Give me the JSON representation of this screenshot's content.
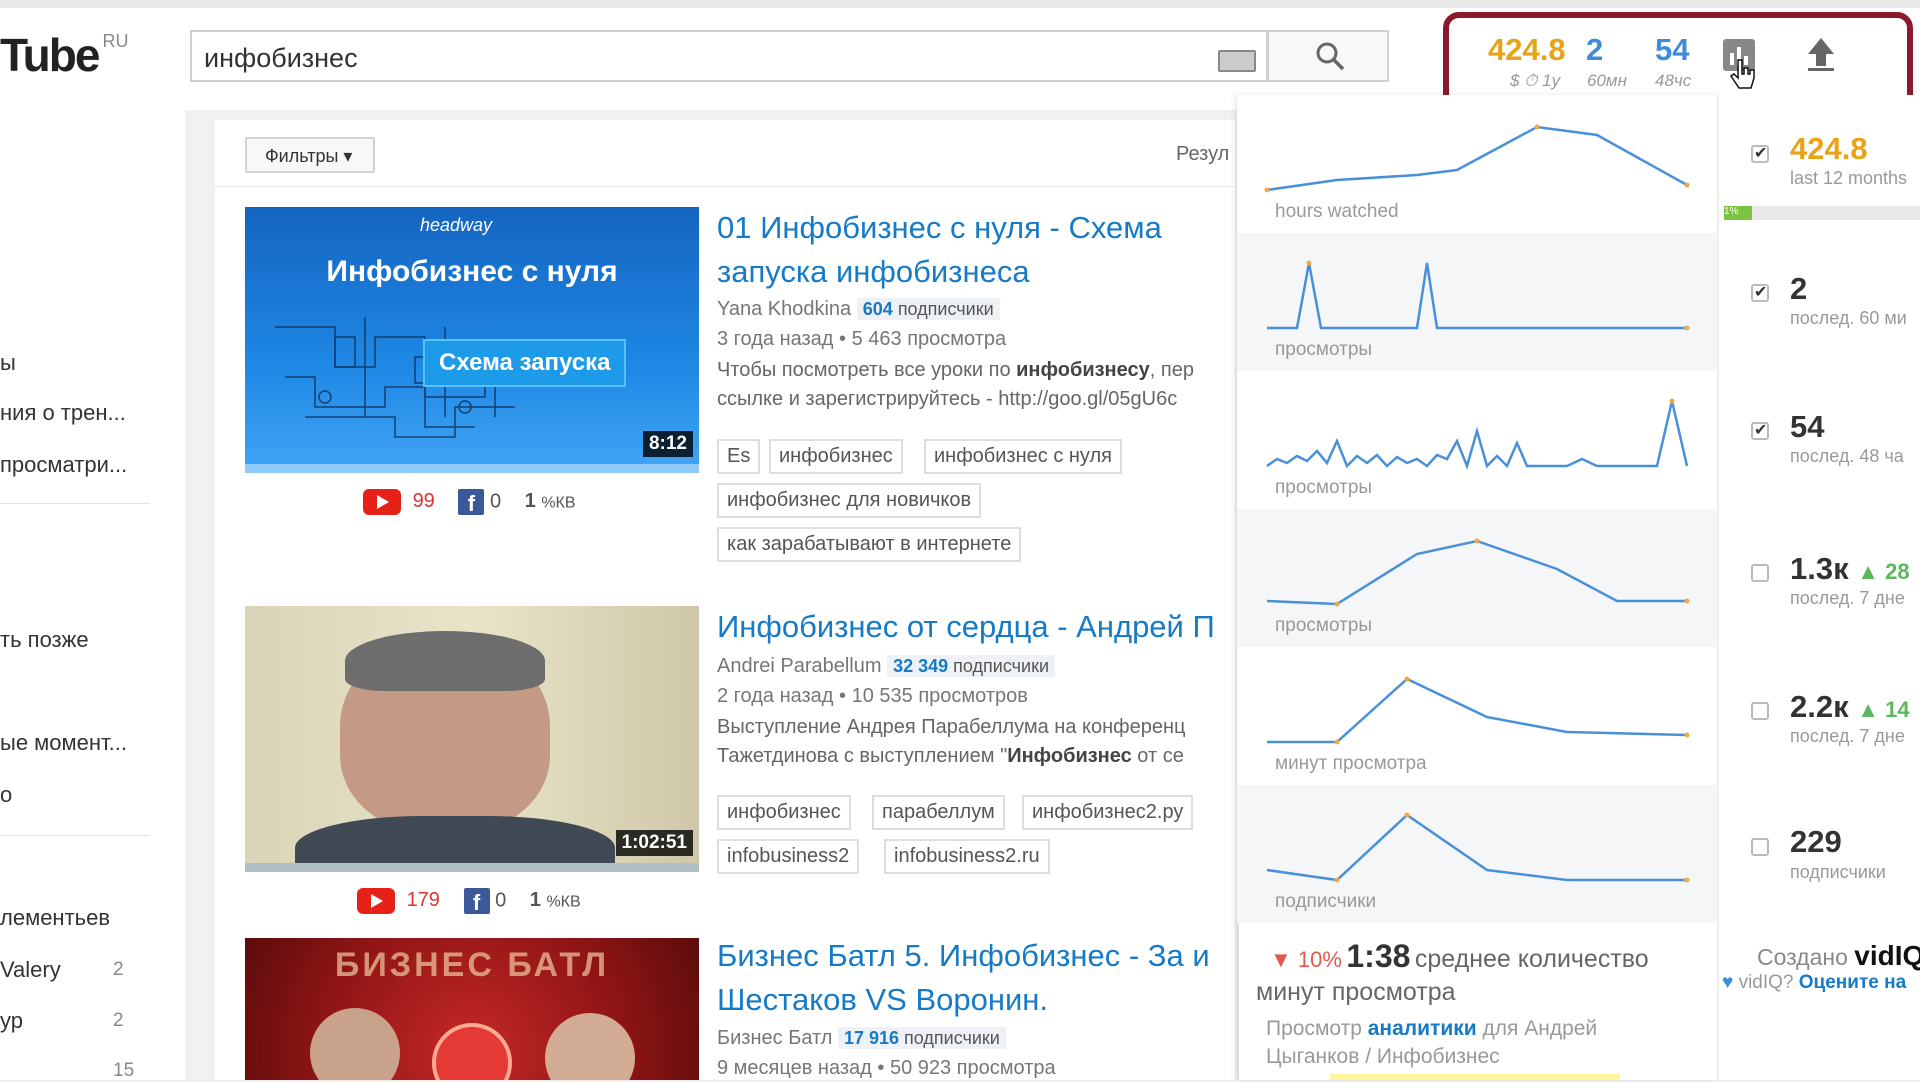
{
  "header": {
    "logo": "Tube",
    "logo_region": "RU",
    "search_value": "инфобизнес"
  },
  "vidiq_bar": {
    "views_per_hour": "424.8",
    "views_per_hour_label": "$ ⏱ 1у",
    "views_60min": "2",
    "views_60min_label": "60мн",
    "views_48h": "54",
    "views_48h_label": "48чс",
    "colors": {
      "gold": "#e8a317",
      "blue": "#3d8cd9",
      "border": "#8b1a2b"
    }
  },
  "sidebar": {
    "items": [
      {
        "label": "ы"
      },
      {
        "label": "ния о трен..."
      },
      {
        "label": "просматри..."
      },
      {
        "label": "ть позже"
      },
      {
        "label": "ые момент..."
      },
      {
        "label": "о"
      },
      {
        "label": "лементьев"
      },
      {
        "label": "Valery",
        "count": "2"
      },
      {
        "label": "ур",
        "count": "2"
      },
      {
        "label": "",
        "count": "15"
      }
    ]
  },
  "filters": {
    "label": "Фильтры ▾",
    "results_label": "Резул"
  },
  "videos": [
    {
      "title": "01 Инфобизнес с нуля - Схема запуска инфобизнеса",
      "channel": "Yana Khodkina",
      "subs_count": "604",
      "subs_label": "подписчики",
      "age": "3 года назад",
      "views": "5 463 просмотра",
      "desc_line1_pre": "Чтобы посмотреть все уроки по ",
      "desc_line1_bold": "инфобизнесу",
      "desc_line1_post": ", пер",
      "desc_line2": "ссылке и зарегистрируйтесь - http://goo.gl/05gU6c",
      "duration": "8:12",
      "thumb_brand": "headway",
      "thumb_title": "Инфобизнес с нуля",
      "thumb_badge": "Схема запуска",
      "tags": [
        "Es",
        "инфобизнес",
        "инфобизнес с нуля",
        "инфобизнес для новичков",
        "как зарабатывают в интернете"
      ],
      "yt_count": "99",
      "fb_count": "0",
      "kb": "1",
      "kb_label": "%КВ"
    },
    {
      "title": "Инфобизнес от сердца - Андрей П",
      "channel": "Andrei Parabellum",
      "subs_count": "32 349",
      "subs_label": "подписчики",
      "age": "2 года назад",
      "views": "10 535 просмотров",
      "desc_line1_pre": "Выступление Андрея Парабеллума на конференц",
      "desc_line1_bold": "",
      "desc_line1_post": "",
      "desc_line2_pre": "Тажетдинова с выступлением \"",
      "desc_line2_bold": "Инфобизнес",
      "desc_line2_post": " от се",
      "duration": "1:02:51",
      "tags": [
        "инфобизнес",
        "парабеллум",
        "инфобизнес2.ру",
        "infobusiness2",
        "infobusiness2.ru"
      ],
      "yt_count": "179",
      "fb_count": "0",
      "kb": "1",
      "kb_label": "%КВ"
    },
    {
      "title": "Бизнес Батл 5. Инфобизнес - За и Шестаков VS Воронин.",
      "title_line1": "Бизнес Батл 5. Инфобизнес - За и",
      "title_line2": "Шестаков VS Воронин.",
      "channel": "Бизнес Батл",
      "subs_count": "17 916",
      "subs_label": "подписчики",
      "age": "9 месяцев назад",
      "views": "50 923 просмотра",
      "thumb_title": "БИЗНЕС БАТЛ"
    }
  ],
  "vidiq_panel": {
    "charts": [
      {
        "label": "hours watched"
      },
      {
        "label": "просмотры"
      },
      {
        "label": "просмотры"
      },
      {
        "label": "просмотры"
      },
      {
        "label": "минут просмотра"
      },
      {
        "label": "подписчики"
      }
    ],
    "stats": [
      {
        "value": "424.8",
        "sub": "last 12 months",
        "checked": true
      },
      {
        "value": "2",
        "sub": "послед. 60 ми",
        "checked": true
      },
      {
        "value": "54",
        "sub": "послед. 48 ча",
        "checked": true
      },
      {
        "value": "1.3к",
        "delta": "▲ 28",
        "sub": "послед. 7 дне",
        "checked": false
      },
      {
        "value": "2.2к",
        "delta": "▲ 14",
        "sub": "послед. 7 дне",
        "checked": false
      },
      {
        "value": "229",
        "sub": "подписчики",
        "checked": false
      }
    ],
    "progress_label": "1%",
    "avg_change": "▼ 10%",
    "avg_duration": "1:38",
    "avg_label_1": "среднее количество",
    "avg_label_2": "минут просмотра",
    "analytics_pre": "Просмотр ",
    "analytics_link": "аналитики",
    "analytics_post": " для Андрей",
    "analytics_line2": "Цыганков / Инфобизнес",
    "created_by": "Создано",
    "created_brand": "vidIQ",
    "rate_pre": "vidIQ? ",
    "rate_link": "Оцените на"
  }
}
